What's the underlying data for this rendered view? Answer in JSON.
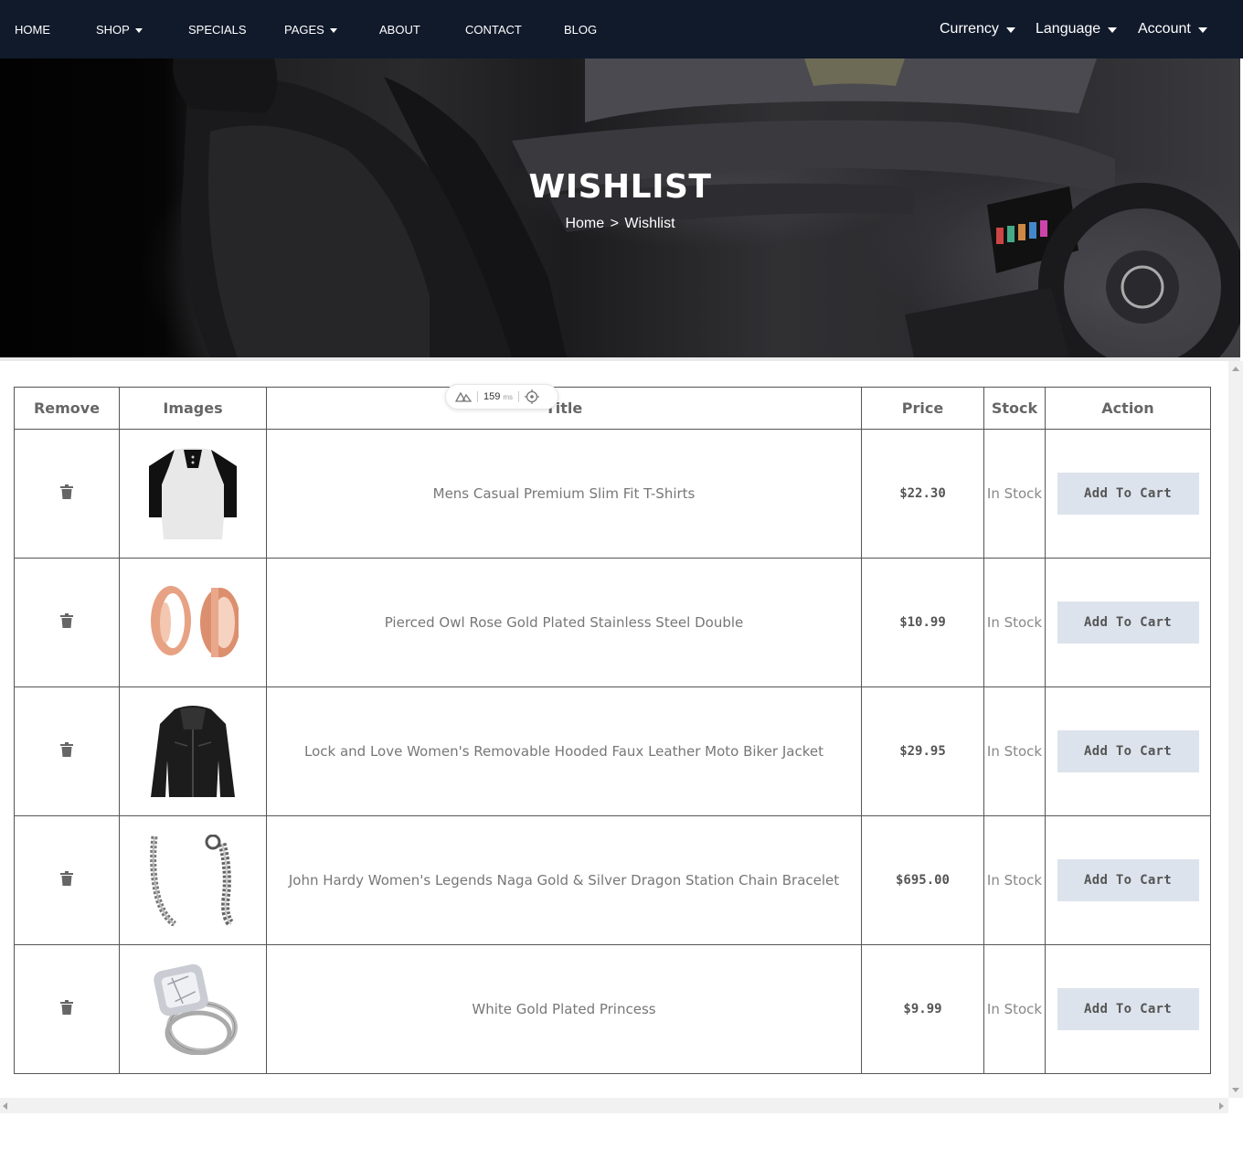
{
  "nav": {
    "items": [
      {
        "label": "HOME",
        "has_caret": false
      },
      {
        "label": "SHOP",
        "has_caret": true
      },
      {
        "label": "SPECIALS",
        "has_caret": false
      },
      {
        "label": "PAGES",
        "has_caret": true
      },
      {
        "label": "ABOUT",
        "has_caret": false
      },
      {
        "label": "CONTACT",
        "has_caret": false
      },
      {
        "label": "BLOG",
        "has_caret": false
      }
    ],
    "right": [
      {
        "label": "Currency"
      },
      {
        "label": "Language"
      },
      {
        "label": "Account"
      }
    ]
  },
  "hero": {
    "title": "WISHLIST",
    "breadcrumb": {
      "home": "Home",
      "separator": ">",
      "current": "Wishlist"
    }
  },
  "devtools": {
    "ms_value": "159",
    "ms_unit": "ms"
  },
  "table": {
    "headers": {
      "remove": "Remove",
      "images": "Images",
      "title": "Title",
      "price": "Price",
      "stock": "Stock",
      "action": "Action"
    },
    "rows": [
      {
        "title": "Mens Casual Premium Slim Fit T-Shirts",
        "price": "$22.30",
        "stock": "In Stock",
        "action": "Add To Cart",
        "image": "raglan-tshirt"
      },
      {
        "title": "Pierced Owl Rose Gold Plated Stainless Steel Double",
        "price": "$10.99",
        "stock": "In Stock",
        "action": "Add To Cart",
        "image": "rose-gold-rings"
      },
      {
        "title": "Lock and Love Women's Removable Hooded Faux Leather Moto Biker Jacket",
        "price": "$29.95",
        "stock": "In Stock",
        "action": "Add To Cart",
        "image": "leather-jacket"
      },
      {
        "title": "John Hardy Women's Legends Naga Gold & Silver Dragon Station Chain Bracelet",
        "price": "$695.00",
        "stock": "In Stock",
        "action": "Add To Cart",
        "image": "silver-chain-bracelet"
      },
      {
        "title": "White Gold Plated Princess",
        "price": "$9.99",
        "stock": "In Stock",
        "action": "Add To Cart",
        "image": "diamond-ring"
      }
    ]
  },
  "colors": {
    "navbar_bg": "#111a2b",
    "button_bg": "#dde3ec",
    "border": "#555555"
  }
}
